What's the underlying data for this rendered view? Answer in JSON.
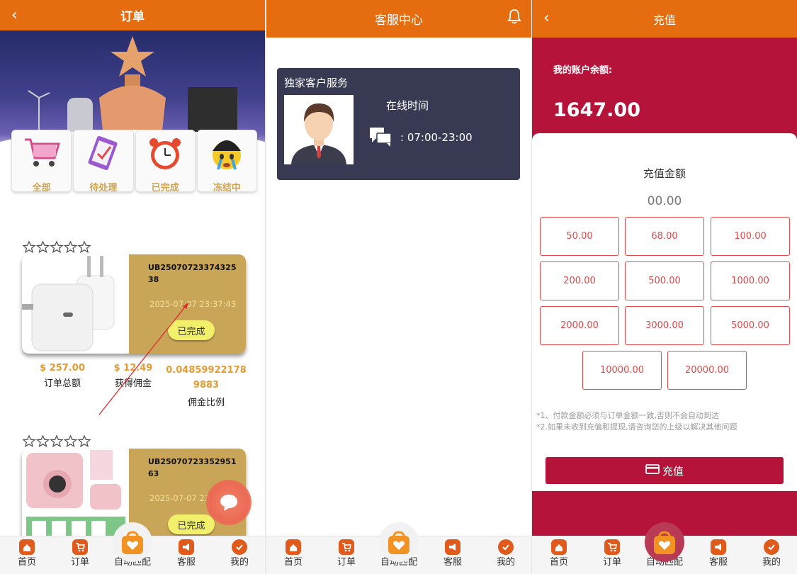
{
  "orders_panel": {
    "title": "订单",
    "categories": [
      {
        "label": "全部",
        "icon": "shopping-cart-icon"
      },
      {
        "label": "待处理",
        "icon": "clipboard-icon"
      },
      {
        "label": "已完成",
        "icon": "alarm-clock-icon"
      },
      {
        "label": "冻结中",
        "icon": "crying-emoji-icon"
      }
    ],
    "orders": [
      {
        "id": "UB2507072337432538",
        "time": "2025-07-07 23:37:43",
        "status": "已完成",
        "rating_stars": 0,
        "product_icon": "charger-icon"
      },
      {
        "id": "UB2507072335295163",
        "time": "2025-07-07 23:35:29",
        "status": "已完成",
        "rating_stars": 0,
        "product_icon": "instant-camera-icon"
      }
    ],
    "stats": [
      {
        "value": "$ 257.00",
        "label": "订单总额"
      },
      {
        "value": "$ 12.49",
        "label": "获得佣金"
      },
      {
        "value": "0.048599221789883",
        "label": "佣金比例"
      }
    ]
  },
  "service_panel": {
    "title": "客服中心",
    "card_title": "独家客户服务",
    "online_label": "在线时间",
    "hours": ": 07:00-23:00"
  },
  "recharge_panel": {
    "title": "充值",
    "balance_label": "我的账户余额:",
    "balance": "1647.00",
    "amount_label": "充值金额",
    "amount_value": "00.00",
    "amounts": [
      "50.00",
      "68.00",
      "100.00",
      "200.00",
      "500.00",
      "1000.00",
      "2000.00",
      "3000.00",
      "5000.00",
      "10000.00",
      "20000.00"
    ],
    "notes": [
      "*1、付款金额必须与订单金额一致,否则不会自动到达",
      "*2.如果未收到充值和提现,请咨询您的上级以解决其他问题"
    ],
    "button_label": "充值"
  },
  "tabbar": [
    {
      "label": "首页",
      "icon": "home-icon"
    },
    {
      "label": "订单",
      "icon": "cart-icon"
    },
    {
      "label": "自动匹配",
      "icon": "shopping-bag-heart-icon"
    },
    {
      "label": "客服",
      "icon": "megaphone-icon"
    },
    {
      "label": "我的",
      "icon": "profile-check-icon"
    }
  ],
  "colors": {
    "header": "#e56d10",
    "recharge_red": "#b5133a",
    "gold_card": "#c9a657",
    "amount_border": "#e44a4a"
  }
}
